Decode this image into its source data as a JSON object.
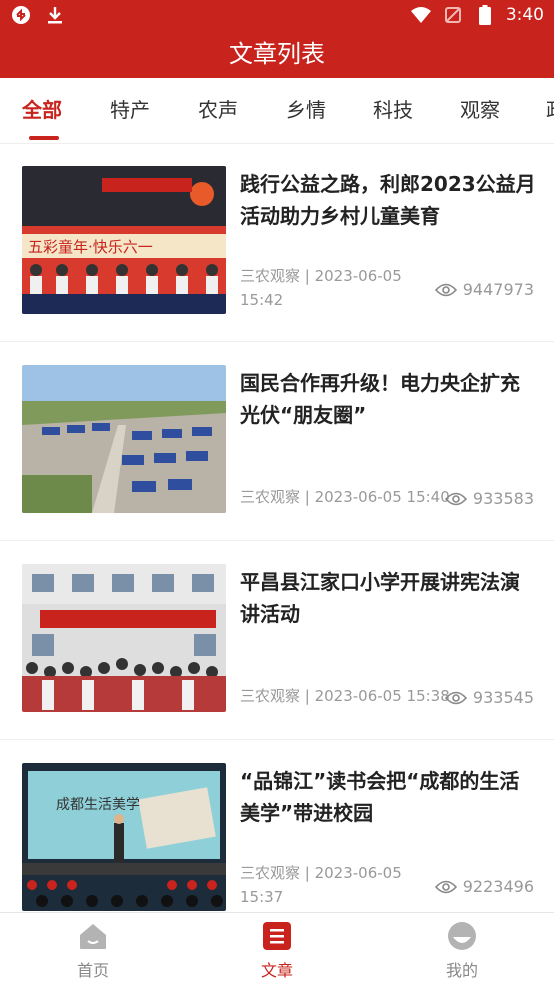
{
  "status_bar": {
    "time": "3:40"
  },
  "header": {
    "title": "文章列表"
  },
  "tabs": [
    {
      "label": "全部",
      "active": true
    },
    {
      "label": "特产",
      "active": false
    },
    {
      "label": "农声",
      "active": false
    },
    {
      "label": "乡情",
      "active": false
    },
    {
      "label": "科技",
      "active": false
    },
    {
      "label": "观察",
      "active": false
    },
    {
      "label": "政",
      "active": false
    }
  ],
  "articles": [
    {
      "title": "践行公益之路，利郎2023公益月活动助力乡村儿童美育",
      "meta": "三农观察 | 2023-06-05 15:42",
      "views": "9447973",
      "thumb_banner_text": "五彩童年·快乐六一"
    },
    {
      "title": "国民合作再升级！电力央企扩充光伏“朋友圈”",
      "meta": "三农观察 | 2023-06-05 15:40",
      "views": "933583"
    },
    {
      "title": "平昌县江家口小学开展讲宪法演讲活动",
      "meta": "三农观察 | 2023-06-05 15:38",
      "views": "933545"
    },
    {
      "title": "“品锦江”读书会把“成都的生活美学”带进校园",
      "meta": "三农观察 | 2023-06-05 15:37",
      "views": "9223496",
      "thumb_banner_text": "成都生活美学"
    }
  ],
  "bottom_nav": [
    {
      "label": "首页",
      "icon": "home-icon",
      "active": false
    },
    {
      "label": "文章",
      "icon": "article-icon",
      "active": true
    },
    {
      "label": "我的",
      "icon": "profile-icon",
      "active": false
    }
  ],
  "colors": {
    "brand": "#c8231d",
    "muted": "#999999"
  }
}
